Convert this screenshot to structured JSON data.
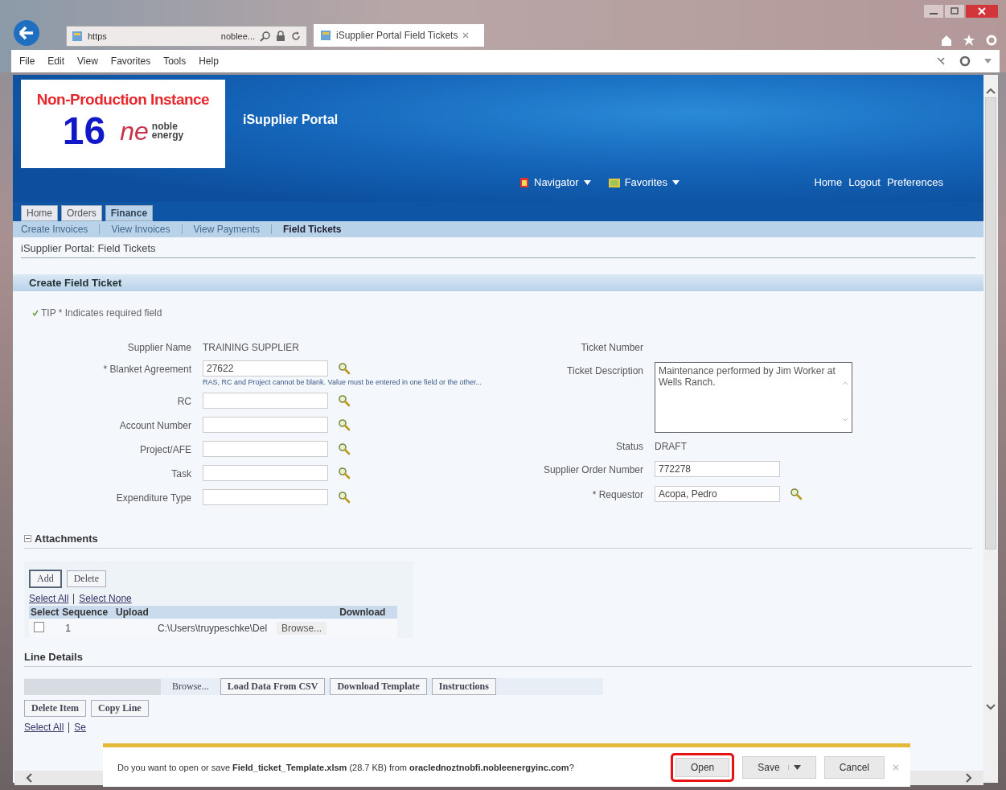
{
  "browser": {
    "address_scheme": "https",
    "address_host": "noblee...",
    "tab_title": "iSupplier Portal Field Tickets",
    "menu": [
      "File",
      "Edit",
      "View",
      "Favorites",
      "Tools",
      "Help"
    ]
  },
  "header": {
    "banner": "Non-Production Instance",
    "instance": "16",
    "logo_mark": "ne",
    "logo_words": [
      "noble",
      "energy"
    ],
    "app_title": "iSupplier Portal",
    "global_menus": [
      "Navigator",
      "Favorites"
    ],
    "global_links": [
      "Home",
      "Logout",
      "Preferences"
    ]
  },
  "tabs": [
    {
      "label": "Home",
      "selected": false
    },
    {
      "label": "Orders",
      "selected": false
    },
    {
      "label": "Finance",
      "selected": true
    }
  ],
  "subtabs": [
    {
      "label": "Create Invoices",
      "selected": false
    },
    {
      "label": "View Invoices",
      "selected": false
    },
    {
      "label": "View Payments",
      "selected": false
    },
    {
      "label": "Field Tickets",
      "selected": true
    }
  ],
  "page_title": "iSupplier Portal: Field Tickets",
  "section_title": "Create Field Ticket",
  "tip": {
    "label": "TIP",
    "text": "* Indicates required field"
  },
  "left_fields": [
    {
      "kind": "text",
      "label": "Supplier Name",
      "value": "TRAINING SUPPLIER"
    },
    {
      "kind": "input",
      "label": "* Blanket Agreement",
      "value": "27622",
      "lookup": true,
      "hint": "RAS, RC and Project cannot be blank. Value must be entered in one field or the other..."
    },
    {
      "kind": "input",
      "label": "RC",
      "lookup": true
    },
    {
      "kind": "input",
      "label": "Account Number",
      "lookup": true
    },
    {
      "kind": "input",
      "label": "Project/AFE",
      "lookup": true
    },
    {
      "kind": "input",
      "label": "Task",
      "lookup": true
    },
    {
      "kind": "input",
      "label": "Expenditure Type",
      "lookup": true
    }
  ],
  "right_fields": [
    {
      "kind": "text",
      "label": "Ticket Number"
    },
    {
      "kind": "textarea",
      "label": "Ticket Description",
      "value": "Maintenance performed by Jim Worker at Wells Ranch."
    },
    {
      "kind": "text",
      "label": "Status",
      "value": "DRAFT"
    },
    {
      "kind": "input",
      "label": "Supplier Order Number",
      "value": "772278"
    },
    {
      "kind": "input",
      "label": "* Requestor",
      "value": "Acopa, Pedro",
      "lookup": true
    }
  ],
  "attachments": {
    "title": "Attachments",
    "expanded": true,
    "buttons": [
      {
        "label": "Add",
        "focused": true
      },
      {
        "label": "Delete",
        "focused": false
      }
    ],
    "links": [
      "Select All",
      "Select None"
    ],
    "columns": [
      "Select",
      "Sequence",
      "Upload",
      "Download"
    ],
    "rows": [
      {
        "checked": false,
        "sequence": "1",
        "upload": "C:\\Users\\truypeschke\\Del",
        "browse": "Browse..."
      }
    ]
  },
  "line_details": {
    "title": "Line Details",
    "browse": "Browse...",
    "buttons": [
      "Load Data From CSV",
      "Download Template",
      "Instructions"
    ],
    "row_buttons": [
      "Delete Item",
      "Copy Line"
    ],
    "links": [
      "Select All",
      "Se"
    ]
  },
  "download_bar": {
    "message": "Do you want to open or save **Field_ticket_Template.xlsm** (28.7 KB) from **oraclednoztnobfi.nobleenergyinc.com**?",
    "buttons": [
      {
        "label": "Open",
        "kind": "plain",
        "highlighted": true
      },
      {
        "label": "Save",
        "kind": "split",
        "highlighted": false
      },
      {
        "label": "Cancel",
        "kind": "plain",
        "highlighted": false
      }
    ]
  }
}
